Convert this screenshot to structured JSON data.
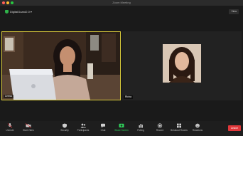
{
  "window": {
    "title": "Zoom Meeting"
  },
  "meeting": {
    "label": "DigitalGuard2.0 ▾",
    "view_button": "View"
  },
  "participants": [
    {
      "name": "Leena"
    },
    {
      "name": "Richa"
    }
  ],
  "toolbar": {
    "items": [
      {
        "label": "Unmute",
        "icon": "microphone-icon"
      },
      {
        "label": "Start Video",
        "icon": "video-camera-icon"
      },
      {
        "label": "Security",
        "icon": "shield-icon"
      },
      {
        "label": "Participants",
        "icon": "people-icon"
      },
      {
        "label": "Chat",
        "icon": "chat-icon"
      },
      {
        "label": "Share Screen",
        "icon": "share-screen-icon"
      },
      {
        "label": "Polling",
        "icon": "bar-chart-icon"
      },
      {
        "label": "Record",
        "icon": "record-icon"
      },
      {
        "label": "Breakout Rooms",
        "icon": "breakout-rooms-icon"
      },
      {
        "label": "Reactions",
        "icon": "smiley-icon"
      }
    ],
    "leave_label": "Leave"
  },
  "colors": {
    "accent_yellow": "#d8c93a",
    "share_green": "#2fcf5a",
    "leave_red": "#e0373a"
  }
}
